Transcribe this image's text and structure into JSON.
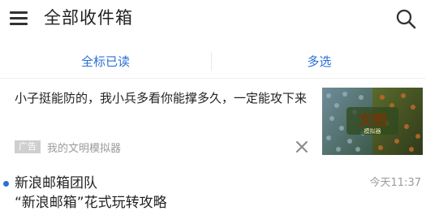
{
  "topbar": {
    "title": "全部收件箱",
    "menu_icon": "hamburger-menu-icon",
    "search_icon": "search-icon"
  },
  "actions": {
    "mark_all_read": "全标已读",
    "multi_select": "多选"
  },
  "ad": {
    "text": "小子挺能防的，我小兵多看你能撑多久，一定能攻下来",
    "badge": "广告",
    "source": "我的文明模拟器",
    "close_icon": "close-icon",
    "image_caption": "文明",
    "image_subcaption": "模拟器"
  },
  "mail": {
    "sender": "新浪邮箱团队",
    "time": "今天11:37",
    "subject": "“新浪邮箱”花式玩转攻略",
    "unread": true
  },
  "colors": {
    "accent": "#2a6fd6",
    "text": "#222222",
    "muted": "#9a9a9a"
  }
}
